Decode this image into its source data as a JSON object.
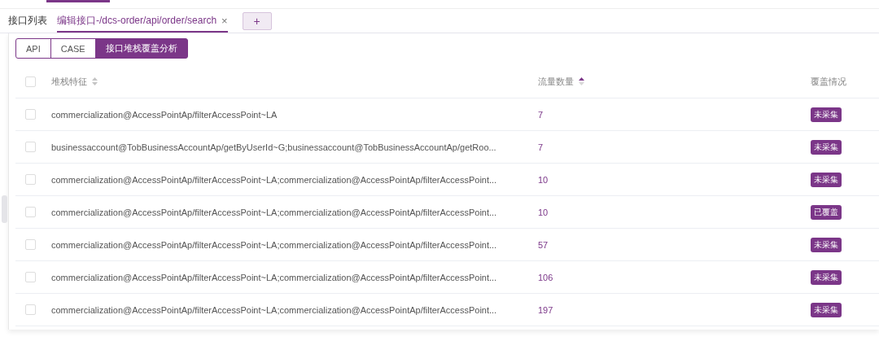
{
  "tabs": [
    {
      "label": "接口列表",
      "selected": false,
      "closable": false
    },
    {
      "label": "编辑接口-/dcs-order/api/order/search",
      "selected": true,
      "closable": true
    }
  ],
  "add_tab": "+",
  "close_mark": "×",
  "segments": [
    {
      "label": "API",
      "selected": false
    },
    {
      "label": "CASE",
      "selected": false
    },
    {
      "label": "接口堆栈覆盖分析",
      "selected": true
    }
  ],
  "table": {
    "columns": [
      {
        "label": "堆栈特征",
        "sorted": false
      },
      {
        "label": "流量数量",
        "sorted": true
      },
      {
        "label": "覆盖情况"
      }
    ],
    "header_checked": false,
    "rows": [
      {
        "checked": false,
        "stack": "commercialization@AccessPointAp/filterAccessPoint~LA",
        "count": "7",
        "status": "未采集"
      },
      {
        "checked": false,
        "stack": "businessaccount@TobBusinessAccountAp/getByUserId~G;businessaccount@TobBusinessAccountAp/getRoo...",
        "count": "7",
        "status": "未采集"
      },
      {
        "checked": false,
        "stack": "commercialization@AccessPointAp/filterAccessPoint~LA;commercialization@AccessPointAp/filterAccessPoint...",
        "count": "10",
        "status": "未采集"
      },
      {
        "checked": false,
        "stack": "commercialization@AccessPointAp/filterAccessPoint~LA;commercialization@AccessPointAp/filterAccessPoint...",
        "count": "10",
        "status": "已覆盖"
      },
      {
        "checked": false,
        "stack": "commercialization@AccessPointAp/filterAccessPoint~LA;commercialization@AccessPointAp/filterAccessPoint...",
        "count": "57",
        "status": "未采集"
      },
      {
        "checked": false,
        "stack": "commercialization@AccessPointAp/filterAccessPoint~LA;commercialization@AccessPointAp/filterAccessPoint...",
        "count": "106",
        "status": "未采集"
      },
      {
        "checked": false,
        "stack": "commercialization@AccessPointAp/filterAccessPoint~LA;commercialization@AccessPointAp/filterAccessPoint...",
        "count": "197",
        "status": "未采集"
      }
    ]
  }
}
